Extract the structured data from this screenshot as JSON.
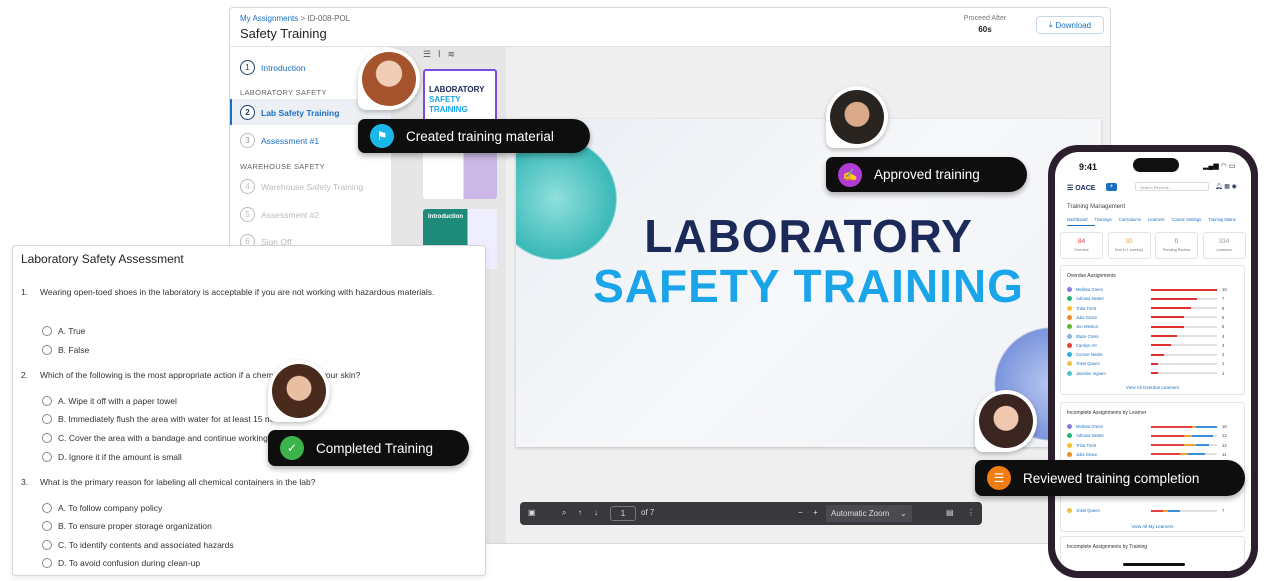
{
  "header": {
    "breadcrumb_link": "My Assignments",
    "breadcrumb_sep": ">",
    "breadcrumb_current": "ID-008-POL",
    "title": "Safety Training",
    "proceed_label": "Proceed After",
    "proceed_value": "60s",
    "download_label": "Download"
  },
  "sidebar": {
    "sections": [
      "LABORATORY SAFETY",
      "WAREHOUSE SAFETY"
    ],
    "steps": [
      {
        "n": "1",
        "label": "Introduction",
        "state": "done"
      },
      {
        "n": "2",
        "label": "Lab Safety Training",
        "state": "active"
      },
      {
        "n": "3",
        "label": "Assessment #1",
        "state": "available"
      },
      {
        "n": "4",
        "label": "Warehouse Safety Training",
        "state": "disabled"
      },
      {
        "n": "5",
        "label": "Assessment #2",
        "state": "disabled"
      },
      {
        "n": "6",
        "label": "Sign Off",
        "state": "disabled"
      }
    ]
  },
  "thumbnails": {
    "first_title_1": "LABORATORY",
    "first_title_2": "SAFETY TRAINING",
    "third_title": "Introduction"
  },
  "slide": {
    "line1": "LABORATORY",
    "line2": "SAFETY TRAINING"
  },
  "pdf_toolbar": {
    "page": "1",
    "of": "of 7",
    "zoom": "Automatic Zoom"
  },
  "quiz": {
    "title": "Laboratory Safety Assessment",
    "questions": [
      {
        "n": "1.",
        "text": "Wearing open-toed shoes in the laboratory is acceptable if you are not working with hazardous materials.",
        "options": [
          "A.  True",
          "B.  False"
        ]
      },
      {
        "n": "2.",
        "text": "Which of the following is the most appropriate action if a chemical spills on your skin?",
        "options": [
          "A.  Wipe it off with a paper towel",
          "B.  Immediately flush the area with water for at least 15 minutes",
          "C.  Cover the area with a bandage and continue working",
          "D.  Ignore it if the amount is small"
        ]
      },
      {
        "n": "3.",
        "text": "What is the primary reason for labeling all chemical containers in the lab?",
        "options": [
          "A.  To follow company policy",
          "B.  To ensure proper storage organization",
          "C.  To identify contents and associated hazards",
          "D.  To avoid confusion during clean-up"
        ]
      }
    ]
  },
  "badges": {
    "created": "Created training material",
    "approved": "Approved training",
    "completed": "Completed Training",
    "reviewed": "Reviewed training completion"
  },
  "colors": {
    "created_icon": "#1ab8e8",
    "approved_icon": "#b23ad6",
    "completed_icon": "#3cb44b",
    "reviewed_icon": "#f07d12",
    "slide_navy": "#1b2a58",
    "slide_cyan": "#1aa5ea",
    "accent": "#1a6fc2"
  },
  "phone": {
    "time": "9:41",
    "logo": "ACE",
    "search_placeholder": "Search Records...",
    "page_title": "Training Management",
    "tabs": [
      "Dashboard",
      "Trainings",
      "Curriculums",
      "Learners",
      "Course Settings",
      "Training Matrix"
    ],
    "stats": [
      {
        "value": "84",
        "label": "Overdue",
        "color": "#e04040"
      },
      {
        "value": "30",
        "label": "Due in 1 week(s)",
        "color": "#f0a030"
      },
      {
        "value": "0",
        "label": "Pending Review",
        "color": "#3a8fd8"
      },
      {
        "value": "334",
        "label": "Learners",
        "color": "#999999"
      }
    ],
    "overdue": {
      "title": "Overdue Assignments",
      "link": "View All Overdue Learners",
      "max": 10,
      "rows": [
        {
          "name": "Melissa Green",
          "value": 10,
          "color": "#8a7be0"
        },
        {
          "name": "Adriana Nester",
          "value": 7,
          "color": "#22b573"
        },
        {
          "name": "Trina Trent",
          "value": 6,
          "color": "#f2c230"
        },
        {
          "name": "Julia Grace",
          "value": 5,
          "color": "#f08a24"
        },
        {
          "name": "Jen Weston",
          "value": 5,
          "color": "#5cb82e"
        },
        {
          "name": "Blaze Cross",
          "value": 4,
          "color": "#8fb4e0"
        },
        {
          "name": "Carolyn Art",
          "value": 3,
          "color": "#e8452c"
        },
        {
          "name": "Conner Nestle",
          "value": 2,
          "color": "#2fb0d8"
        },
        {
          "name": "Yosel Queen",
          "value": 1,
          "color": "#f0c040"
        },
        {
          "name": "Jasmine Ingram",
          "value": 1,
          "color": "#4ac8d0"
        }
      ]
    },
    "incomplete": {
      "title": "Incomplete Assignments by Learner",
      "link": "View All My Learners",
      "max": 16,
      "rows": [
        {
          "name": "Melissa Green",
          "value": 16,
          "color": "#8a7be0",
          "parts": [
            10,
            1,
            5
          ]
        },
        {
          "name": "Adriana Nester",
          "value": 12,
          "color": "#22b573",
          "parts": [
            8,
            2,
            5
          ]
        },
        {
          "name": "Trina Trent",
          "value": 12,
          "color": "#f2c230",
          "parts": [
            8,
            3,
            3
          ]
        },
        {
          "name": "Julia Grace",
          "value": 11,
          "color": "#f08a24",
          "parts": [
            7,
            2,
            4
          ]
        },
        {
          "name": "Blaze Cross",
          "value": 10,
          "color": "#8fb4e0",
          "parts": [
            6,
            0,
            5
          ]
        },
        {
          "name": "Yosel Queen",
          "value": 7,
          "color": "#f0c040",
          "parts": [
            3,
            1,
            3
          ]
        }
      ]
    },
    "by_training_title": "Incomplete Assignments by Training"
  }
}
